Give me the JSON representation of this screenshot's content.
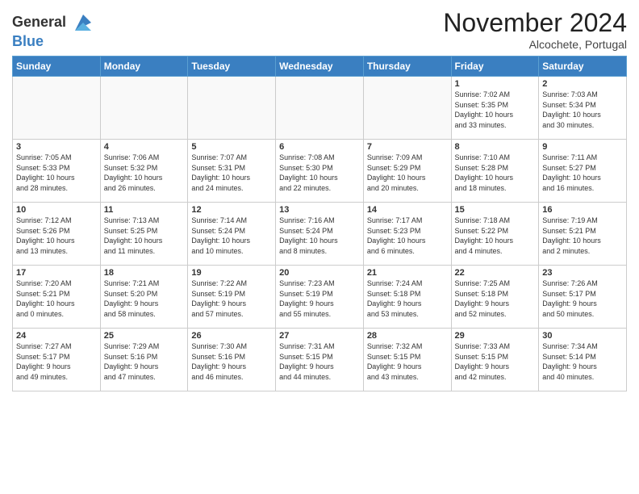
{
  "header": {
    "logo_line1": "General",
    "logo_line2": "Blue",
    "month": "November 2024",
    "location": "Alcochete, Portugal"
  },
  "days_of_week": [
    "Sunday",
    "Monday",
    "Tuesday",
    "Wednesday",
    "Thursday",
    "Friday",
    "Saturday"
  ],
  "weeks": [
    [
      {
        "day": "",
        "info": ""
      },
      {
        "day": "",
        "info": ""
      },
      {
        "day": "",
        "info": ""
      },
      {
        "day": "",
        "info": ""
      },
      {
        "day": "",
        "info": ""
      },
      {
        "day": "1",
        "info": "Sunrise: 7:02 AM\nSunset: 5:35 PM\nDaylight: 10 hours\nand 33 minutes."
      },
      {
        "day": "2",
        "info": "Sunrise: 7:03 AM\nSunset: 5:34 PM\nDaylight: 10 hours\nand 30 minutes."
      }
    ],
    [
      {
        "day": "3",
        "info": "Sunrise: 7:05 AM\nSunset: 5:33 PM\nDaylight: 10 hours\nand 28 minutes."
      },
      {
        "day": "4",
        "info": "Sunrise: 7:06 AM\nSunset: 5:32 PM\nDaylight: 10 hours\nand 26 minutes."
      },
      {
        "day": "5",
        "info": "Sunrise: 7:07 AM\nSunset: 5:31 PM\nDaylight: 10 hours\nand 24 minutes."
      },
      {
        "day": "6",
        "info": "Sunrise: 7:08 AM\nSunset: 5:30 PM\nDaylight: 10 hours\nand 22 minutes."
      },
      {
        "day": "7",
        "info": "Sunrise: 7:09 AM\nSunset: 5:29 PM\nDaylight: 10 hours\nand 20 minutes."
      },
      {
        "day": "8",
        "info": "Sunrise: 7:10 AM\nSunset: 5:28 PM\nDaylight: 10 hours\nand 18 minutes."
      },
      {
        "day": "9",
        "info": "Sunrise: 7:11 AM\nSunset: 5:27 PM\nDaylight: 10 hours\nand 16 minutes."
      }
    ],
    [
      {
        "day": "10",
        "info": "Sunrise: 7:12 AM\nSunset: 5:26 PM\nDaylight: 10 hours\nand 13 minutes."
      },
      {
        "day": "11",
        "info": "Sunrise: 7:13 AM\nSunset: 5:25 PM\nDaylight: 10 hours\nand 11 minutes."
      },
      {
        "day": "12",
        "info": "Sunrise: 7:14 AM\nSunset: 5:24 PM\nDaylight: 10 hours\nand 10 minutes."
      },
      {
        "day": "13",
        "info": "Sunrise: 7:16 AM\nSunset: 5:24 PM\nDaylight: 10 hours\nand 8 minutes."
      },
      {
        "day": "14",
        "info": "Sunrise: 7:17 AM\nSunset: 5:23 PM\nDaylight: 10 hours\nand 6 minutes."
      },
      {
        "day": "15",
        "info": "Sunrise: 7:18 AM\nSunset: 5:22 PM\nDaylight: 10 hours\nand 4 minutes."
      },
      {
        "day": "16",
        "info": "Sunrise: 7:19 AM\nSunset: 5:21 PM\nDaylight: 10 hours\nand 2 minutes."
      }
    ],
    [
      {
        "day": "17",
        "info": "Sunrise: 7:20 AM\nSunset: 5:21 PM\nDaylight: 10 hours\nand 0 minutes."
      },
      {
        "day": "18",
        "info": "Sunrise: 7:21 AM\nSunset: 5:20 PM\nDaylight: 9 hours\nand 58 minutes."
      },
      {
        "day": "19",
        "info": "Sunrise: 7:22 AM\nSunset: 5:19 PM\nDaylight: 9 hours\nand 57 minutes."
      },
      {
        "day": "20",
        "info": "Sunrise: 7:23 AM\nSunset: 5:19 PM\nDaylight: 9 hours\nand 55 minutes."
      },
      {
        "day": "21",
        "info": "Sunrise: 7:24 AM\nSunset: 5:18 PM\nDaylight: 9 hours\nand 53 minutes."
      },
      {
        "day": "22",
        "info": "Sunrise: 7:25 AM\nSunset: 5:18 PM\nDaylight: 9 hours\nand 52 minutes."
      },
      {
        "day": "23",
        "info": "Sunrise: 7:26 AM\nSunset: 5:17 PM\nDaylight: 9 hours\nand 50 minutes."
      }
    ],
    [
      {
        "day": "24",
        "info": "Sunrise: 7:27 AM\nSunset: 5:17 PM\nDaylight: 9 hours\nand 49 minutes."
      },
      {
        "day": "25",
        "info": "Sunrise: 7:29 AM\nSunset: 5:16 PM\nDaylight: 9 hours\nand 47 minutes."
      },
      {
        "day": "26",
        "info": "Sunrise: 7:30 AM\nSunset: 5:16 PM\nDaylight: 9 hours\nand 46 minutes."
      },
      {
        "day": "27",
        "info": "Sunrise: 7:31 AM\nSunset: 5:15 PM\nDaylight: 9 hours\nand 44 minutes."
      },
      {
        "day": "28",
        "info": "Sunrise: 7:32 AM\nSunset: 5:15 PM\nDaylight: 9 hours\nand 43 minutes."
      },
      {
        "day": "29",
        "info": "Sunrise: 7:33 AM\nSunset: 5:15 PM\nDaylight: 9 hours\nand 42 minutes."
      },
      {
        "day": "30",
        "info": "Sunrise: 7:34 AM\nSunset: 5:14 PM\nDaylight: 9 hours\nand 40 minutes."
      }
    ]
  ]
}
